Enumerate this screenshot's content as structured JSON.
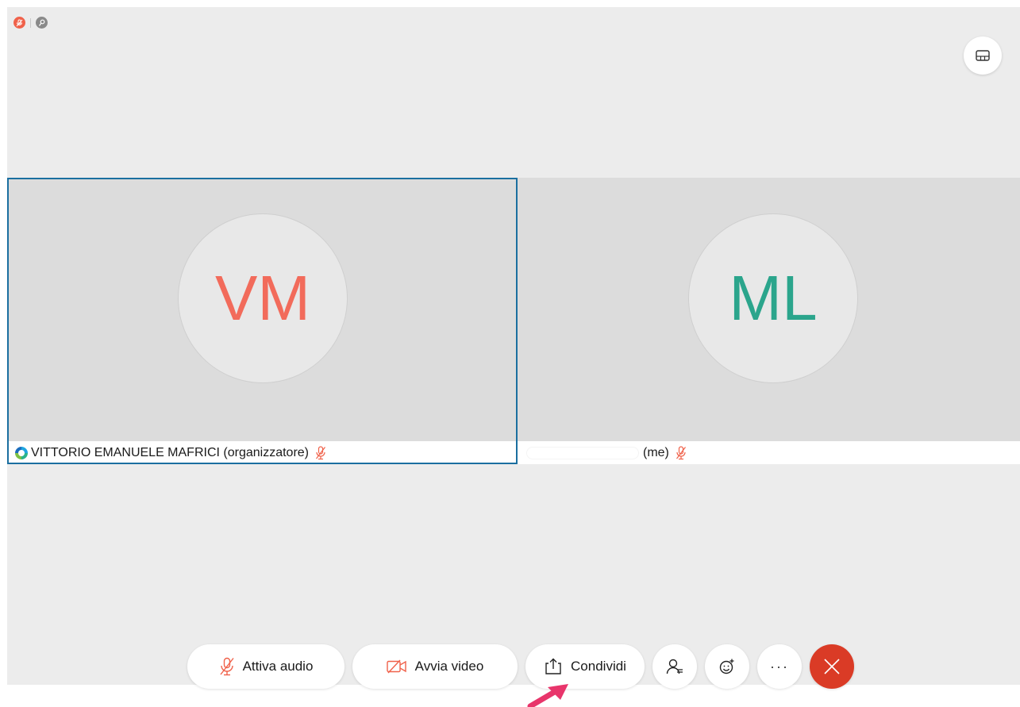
{
  "participants": [
    {
      "initials": "VM",
      "name": "VITTORIO EMANUELE MAFRICI (organizzatore)",
      "avatar_color": "#f26b5b",
      "muted": true,
      "active_speaker": true
    },
    {
      "initials": "ML",
      "name": "(me)",
      "avatar_color": "#2ba58c",
      "muted": true,
      "active_speaker": false
    }
  ],
  "toolbar": {
    "audio_label": "Attiva audio",
    "video_label": "Avvia video",
    "share_label": "Condividi",
    "participants_icon": "participants-icon",
    "reactions_icon": "smiley-icon",
    "more_label": "···",
    "end_icon": "close-icon"
  },
  "colors": {
    "accent_border": "#1b6fa0",
    "muted_red": "#f0614a",
    "end_button": "#da3b26"
  }
}
